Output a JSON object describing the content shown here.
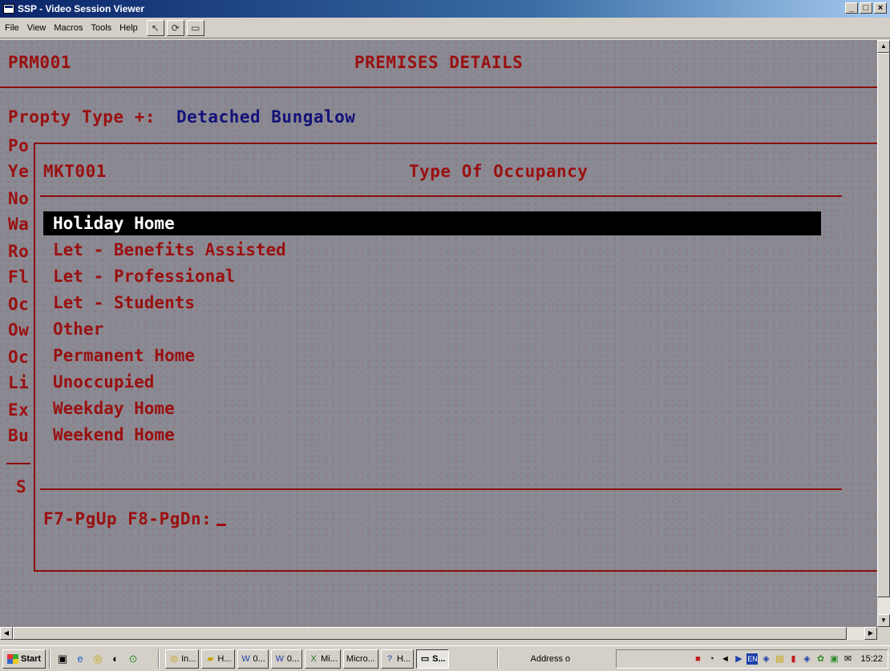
{
  "window": {
    "title": "SSP - Video Session Viewer",
    "buttons": {
      "minimize": "_",
      "maximize": "□",
      "close": "×"
    }
  },
  "menu": {
    "items": [
      "File",
      "View",
      "Macros",
      "Tools",
      "Help"
    ],
    "toolbar_icons": [
      "pointer-icon",
      "refresh-icon",
      "window-icon"
    ]
  },
  "terminal": {
    "screen_id": "PRM001",
    "screen_title": "PREMISES DETAILS",
    "property_type_label": "Propty Type +:",
    "property_type_value": "Detached Bungalow",
    "left_labels": [
      "Po",
      "Ye",
      "No",
      "Wa",
      "Ro",
      "Fl",
      "Oc",
      "Ow",
      "Oc",
      "Li",
      "Ex",
      "Bu"
    ],
    "left_bottom_label": "S",
    "popup": {
      "id": "MKT001",
      "title": "Type Of Occupancy",
      "selected_index": 0,
      "options": [
        "Holiday Home",
        "Let - Benefits Assisted",
        "Let - Professional",
        "Let - Students",
        "Other",
        "Permanent Home",
        "Unoccupied",
        "Weekday Home",
        "Weekend Home"
      ],
      "prompt": "F7-PgUp F8-PgDn:"
    },
    "colors": {
      "background": "#8a8a94",
      "text_red": "#9a1010",
      "text_blue": "#14127a",
      "highlight": "#000000"
    }
  },
  "taskbar": {
    "start_label": "Start",
    "tasks": [
      {
        "icon": "outlook-icon",
        "label": "In..."
      },
      {
        "icon": "folder-icon",
        "label": "H..."
      },
      {
        "icon": "word-icon",
        "label": "0..."
      },
      {
        "icon": "word-icon",
        "label": "0..."
      },
      {
        "icon": "excel-icon",
        "label": "Mi..."
      },
      {
        "icon": "none",
        "label": "Micro..."
      },
      {
        "icon": "help-icon",
        "label": "H..."
      },
      {
        "icon": "window-icon",
        "label": "S..."
      }
    ],
    "address_label": "Address o",
    "clock": "15:22",
    "language": "EN"
  }
}
